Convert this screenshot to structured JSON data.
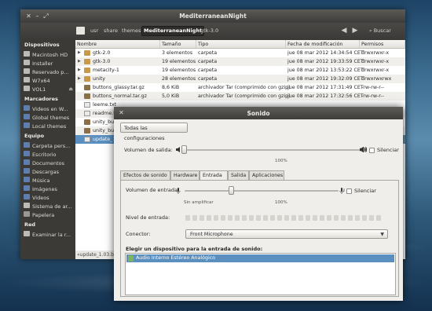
{
  "nautilus": {
    "title": "MediterraneanNight",
    "breadcrumbs": [
      "usr",
      "share",
      "themes",
      "MediterraneanNight",
      "gtk-3.0"
    ],
    "search_label": "Buscar",
    "sidebar": {
      "sections": [
        {
          "heading": "Dispositivos",
          "items": [
            "Macintosh HD",
            "Installer",
            "Reservado p...",
            "W7x64",
            "VOL1"
          ]
        },
        {
          "heading": "Marcadores",
          "items": [
            "Videos en W...",
            "Global themes",
            "Local themes"
          ]
        },
        {
          "heading": "Equipo",
          "items": [
            "Carpeta pers...",
            "Escritorio",
            "Documentos",
            "Descargas",
            "Música",
            "Imágenes",
            "Videos",
            "Sistema de ar...",
            "Papelera"
          ]
        },
        {
          "heading": "Red",
          "items": [
            "Examinar la r..."
          ]
        }
      ]
    },
    "columns": [
      "Nombre",
      "Tamaño",
      "Tipo",
      "Fecha de modificación",
      "Permisos"
    ],
    "files": [
      {
        "name": "gtk-2.0",
        "size": "3 elementos",
        "type": "carpeta",
        "date": "jue 08 mar 2012 14:34:54 CET",
        "perm": "drwxrwxr-x",
        "kind": "folder"
      },
      {
        "name": "gtk-3.0",
        "size": "19 elementos",
        "type": "carpeta",
        "date": "jue 08 mar 2012 19:33:59 CET",
        "perm": "drwxrwxr-x",
        "kind": "folder"
      },
      {
        "name": "metacity-1",
        "size": "19 elementos",
        "type": "carpeta",
        "date": "jue 08 mar 2012 13:53:22 CET",
        "perm": "drwxrwxr-x",
        "kind": "folder"
      },
      {
        "name": "unity",
        "size": "28 elementos",
        "type": "carpeta",
        "date": "jue 08 mar 2012 19:32:09 CET",
        "perm": "drwxrwxrwx",
        "kind": "folder"
      },
      {
        "name": "buttons_glassy.tar.gz",
        "size": "8,6 KiB",
        "type": "archivador Tar (comprimido con gzip)",
        "date": "jue 08 mar 2012 17:31:49 CET",
        "perm": "-rw-rw-r--",
        "kind": "archive"
      },
      {
        "name": "buttons_normal.tar.gz",
        "size": "5,0 KiB",
        "type": "archivador Tar (comprimido con gzip)",
        "date": "jue 08 mar 2012 17:32:56 CET",
        "perm": "-rw-rw-r--",
        "kind": "archive"
      },
      {
        "name": "leeme.txt",
        "size": "",
        "type": "",
        "date": "",
        "perm": "",
        "kind": "doc"
      },
      {
        "name": "readme.t",
        "size": "",
        "type": "",
        "date": "",
        "perm": "",
        "kind": "doc"
      },
      {
        "name": "unity_bu",
        "size": "",
        "type": "",
        "date": "",
        "perm": "",
        "kind": "archive"
      },
      {
        "name": "unity_bu",
        "size": "",
        "type": "",
        "date": "",
        "perm": "",
        "kind": "archive"
      },
      {
        "name": "update_1",
        "size": "",
        "type": "",
        "date": "",
        "perm": "",
        "kind": "doc"
      }
    ],
    "status": "«update_1.03.b"
  },
  "sound": {
    "title": "Sonido",
    "all_settings": "Todas las configuraciones",
    "output_volume_label": "Volumen de salida:",
    "output_volume_level": 0.0,
    "mute_label": "Silenciar",
    "percent_100": "100%",
    "tabs": [
      "Efectos de sonido",
      "Hardware",
      "Entrada",
      "Salida",
      "Aplicaciones"
    ],
    "active_tab": "Entrada",
    "input_volume_label": "Volumen de entrada:",
    "input_volume_level": 0.3,
    "unamplified": "Sin amplificar",
    "input_level_label": "Nivel de entrada:",
    "connector_label": "Conector:",
    "connector_value": "Front Microphone",
    "choose_device_label": "Elegir un dispositivo para la entrada de sonido:",
    "devices": [
      "Audio Interno Estéreo Analógico"
    ]
  }
}
